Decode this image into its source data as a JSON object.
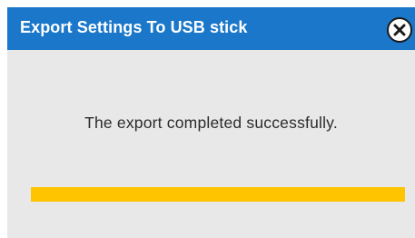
{
  "dialog": {
    "title": "Export Settings To USB stick",
    "close_icon": "close-icon",
    "message": "The export completed successfully.",
    "progress": 1.0
  },
  "colors": {
    "titlebar": "#1a77c9",
    "title_text": "#ffffff",
    "body_background": "#e8e8e8",
    "progress_fill": "#ffc400",
    "message_text": "#2b2b2b"
  }
}
